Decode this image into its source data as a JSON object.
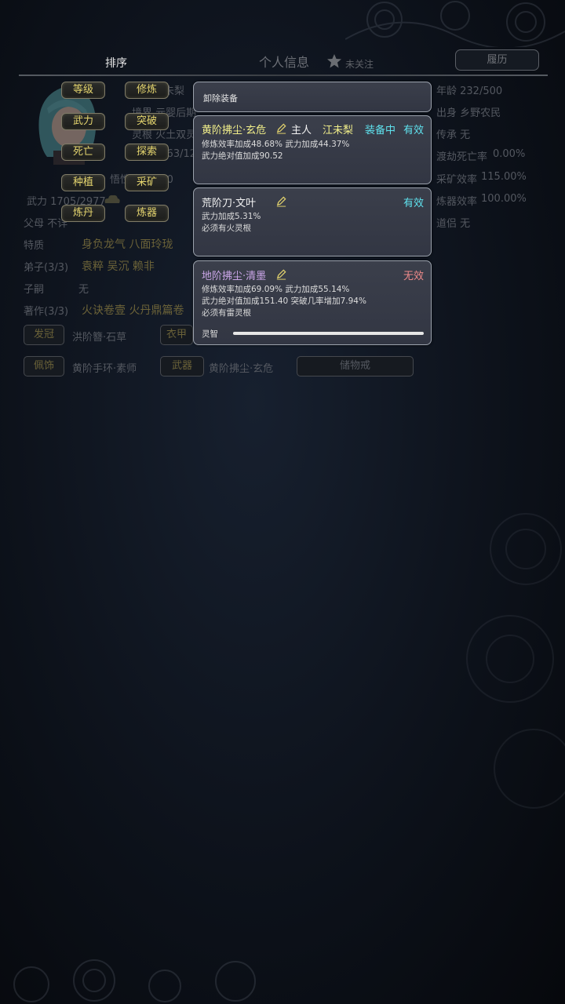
{
  "header": {
    "sort_label": "排序",
    "title": "个人信息",
    "follow_label": "未关注",
    "history_button": "履历"
  },
  "profile": {
    "name_partial": "江未梨",
    "realm": "境界 元婴后期",
    "root": "灵根 火土双灵",
    "cultivation_value": "1063/12",
    "speed": "悟性速度 100",
    "age": "年龄 232/500",
    "origin": "出身 乡野农民",
    "inheritance": "传承 无",
    "death_rate_label": "渡劫死亡率",
    "death_rate_value": "0.00%",
    "mining_label": "采矿效率",
    "mining_value": "115.00%",
    "forge_label": "炼器效率",
    "forge_value": "100.00%",
    "dao_partner": "道侣 无",
    "power": "武力 1705/2977",
    "parents": "父母 不详",
    "traits_label": "特质",
    "traits": "身负龙气 八面玲珑",
    "disciples_label": "弟子(3/3)",
    "disciples": "袁粹 吴沉 赖非",
    "heir_label": "子嗣",
    "heir": "无",
    "works_label": "著作(3/3)",
    "works": "火诀卷壹 火丹鼎篇卷"
  },
  "sort_buttons": [
    "等级",
    "修炼",
    "武力",
    "突破",
    "死亡",
    "探索",
    "种植",
    "采矿",
    "炼丹",
    "炼器"
  ],
  "slots": {
    "crown_label": "发冠",
    "crown_item": "洪阶簪·石草",
    "robe_label": "衣甲",
    "accessory_label": "佩饰",
    "accessory_item": "黄阶手环·素师",
    "weapon_label": "武器",
    "weapon_item": "黄阶拂尘·玄危",
    "storage_label": "储物戒"
  },
  "popup": {
    "unequip_label": "卸除装备",
    "items": [
      {
        "name": "黄阶拂尘·玄危",
        "owner_label": "主人",
        "owner_name": "江未梨",
        "equip_status": "装备中",
        "validity": "有效",
        "line1": "修炼效率加成48.68% 武力加成44.37%",
        "line2": "武力绝对值加成90.52"
      },
      {
        "name": "荒阶刀·文叶",
        "validity": "有效",
        "line1": "武力加成5.31%",
        "line2": "必须有火灵根"
      },
      {
        "name": "地阶拂尘·清墨",
        "validity": "无效",
        "line1": "修炼效率加成69.09% 武力加成55.14%",
        "line2": "武力绝对值加成151.40 突破几率增加7.94%",
        "line3": "必须有雷灵根",
        "spirit_label": "灵智",
        "spirit_level": 1.0
      }
    ]
  },
  "icons": [
    "star-icon",
    "pencil-icon",
    "avatar-portrait",
    "cloud-icon"
  ],
  "colors": {
    "sort_button_text": "#e5d56e",
    "cyan_status": "#5fe3ef",
    "red_status": "#ef8a8a",
    "panel_bg": "#373b47"
  }
}
